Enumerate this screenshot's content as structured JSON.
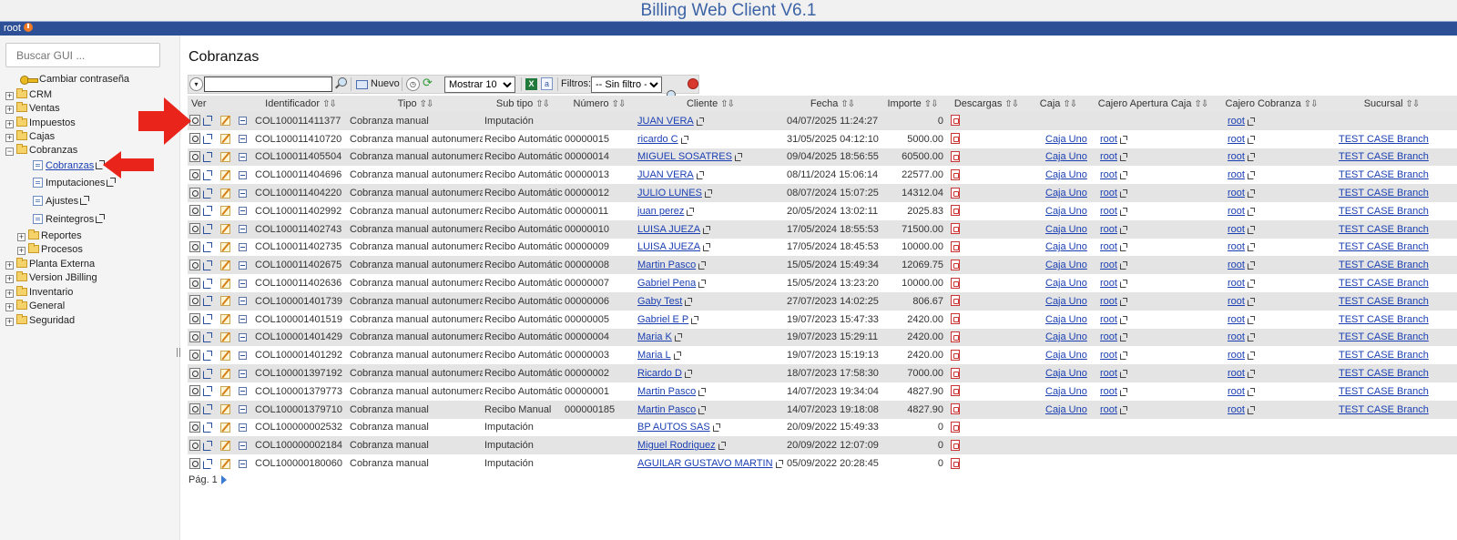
{
  "app": {
    "title": "Billing Web Client V6.1",
    "user": "root"
  },
  "sidebar": {
    "search_placeholder": "Buscar GUI ...",
    "change_password": "Cambiar contraseña",
    "items": [
      {
        "label": "CRM",
        "expanded": false
      },
      {
        "label": "Ventas",
        "expanded": false
      },
      {
        "label": "Impuestos",
        "expanded": false
      },
      {
        "label": "Cajas",
        "expanded": false
      },
      {
        "label": "Cobranzas",
        "expanded": true
      }
    ],
    "cobranzas_children": [
      "Cobranzas",
      "Imputaciones",
      "Ajustes",
      "Reintegros"
    ],
    "cobranzas_folders": [
      "Reportes",
      "Procesos"
    ],
    "bottom_items": [
      "Planta Externa",
      "Version JBilling",
      "Inventario",
      "General",
      "Seguridad"
    ]
  },
  "main": {
    "title": "Cobranzas",
    "toolbar": {
      "new_label": "Nuevo",
      "show_label": "Mostrar 10",
      "filters_label": "Filtros:",
      "filter_value": "-- Sin filtro --"
    },
    "columns": [
      "Ver",
      "Identificador",
      "Tipo",
      "Sub tipo",
      "Número",
      "Cliente",
      "Fecha",
      "Importe",
      "Descargas",
      "Caja",
      "Cajero Apertura Caja",
      "Cajero Cobranza",
      "Sucursal"
    ],
    "rows": [
      {
        "id": "COL100011411377",
        "tipo": "Cobranza manual",
        "subtipo": "Imputación",
        "numero": "",
        "cliente": "JUAN VERA",
        "fecha": "04/07/2025 11:24:27",
        "importe": "0",
        "caja": "",
        "cajero_apertura": "",
        "cajero_cobranza": "root",
        "sucursal": ""
      },
      {
        "id": "COL100011410720",
        "tipo": "Cobranza manual autonumerada",
        "subtipo": "Recibo Automático",
        "numero": "00000015",
        "cliente": "ricardo C",
        "fecha": "31/05/2025 04:12:10",
        "importe": "5000.00",
        "caja": "Caja Uno",
        "cajero_apertura": "root",
        "cajero_cobranza": "root",
        "sucursal": "TEST CASE Branch"
      },
      {
        "id": "COL100011405504",
        "tipo": "Cobranza manual autonumerada",
        "subtipo": "Recibo Automático",
        "numero": "00000014",
        "cliente": "MIGUEL SOSATRES",
        "fecha": "09/04/2025 18:56:55",
        "importe": "60500.00",
        "caja": "Caja Uno",
        "cajero_apertura": "root",
        "cajero_cobranza": "root",
        "sucursal": "TEST CASE Branch"
      },
      {
        "id": "COL100011404696",
        "tipo": "Cobranza manual autonumerada",
        "subtipo": "Recibo Automático",
        "numero": "00000013",
        "cliente": "JUAN VERA",
        "fecha": "08/11/2024 15:06:14",
        "importe": "22577.00",
        "caja": "Caja Uno",
        "cajero_apertura": "root",
        "cajero_cobranza": "root",
        "sucursal": "TEST CASE Branch"
      },
      {
        "id": "COL100011404220",
        "tipo": "Cobranza manual autonumerada",
        "subtipo": "Recibo Automático",
        "numero": "00000012",
        "cliente": "JULIO LUNES",
        "fecha": "08/07/2024 15:07:25",
        "importe": "14312.04",
        "caja": "Caja Uno",
        "cajero_apertura": "root",
        "cajero_cobranza": "root",
        "sucursal": "TEST CASE Branch"
      },
      {
        "id": "COL100011402992",
        "tipo": "Cobranza manual autonumerada",
        "subtipo": "Recibo Automático",
        "numero": "00000011",
        "cliente": "juan perez",
        "fecha": "20/05/2024 13:02:11",
        "importe": "2025.83",
        "caja": "Caja Uno",
        "cajero_apertura": "root",
        "cajero_cobranza": "root",
        "sucursal": "TEST CASE Branch"
      },
      {
        "id": "COL100011402743",
        "tipo": "Cobranza manual autonumerada",
        "subtipo": "Recibo Automático",
        "numero": "00000010",
        "cliente": "LUISA JUEZA",
        "fecha": "17/05/2024 18:55:53",
        "importe": "71500.00",
        "caja": "Caja Uno",
        "cajero_apertura": "root",
        "cajero_cobranza": "root",
        "sucursal": "TEST CASE Branch"
      },
      {
        "id": "COL100011402735",
        "tipo": "Cobranza manual autonumerada",
        "subtipo": "Recibo Automático",
        "numero": "00000009",
        "cliente": "LUISA JUEZA",
        "fecha": "17/05/2024 18:45:53",
        "importe": "10000.00",
        "caja": "Caja Uno",
        "cajero_apertura": "root",
        "cajero_cobranza": "root",
        "sucursal": "TEST CASE Branch"
      },
      {
        "id": "COL100011402675",
        "tipo": "Cobranza manual autonumerada",
        "subtipo": "Recibo Automático",
        "numero": "00000008",
        "cliente": "Martin Pasco",
        "fecha": "15/05/2024 15:49:34",
        "importe": "12069.75",
        "caja": "Caja Uno",
        "cajero_apertura": "root",
        "cajero_cobranza": "root",
        "sucursal": "TEST CASE Branch"
      },
      {
        "id": "COL100011402636",
        "tipo": "Cobranza manual autonumerada",
        "subtipo": "Recibo Automático",
        "numero": "00000007",
        "cliente": "Gabriel Pena",
        "fecha": "15/05/2024 13:23:20",
        "importe": "10000.00",
        "caja": "Caja Uno",
        "cajero_apertura": "root",
        "cajero_cobranza": "root",
        "sucursal": "TEST CASE Branch"
      },
      {
        "id": "COL100001401739",
        "tipo": "Cobranza manual autonumerada",
        "subtipo": "Recibo Automático",
        "numero": "00000006",
        "cliente": "Gaby Test",
        "fecha": "27/07/2023 14:02:25",
        "importe": "806.67",
        "caja": "Caja Uno",
        "cajero_apertura": "root",
        "cajero_cobranza": "root",
        "sucursal": "TEST CASE Branch"
      },
      {
        "id": "COL100001401519",
        "tipo": "Cobranza manual autonumerada",
        "subtipo": "Recibo Automático",
        "numero": "00000005",
        "cliente": "Gabriel E P",
        "fecha": "19/07/2023 15:47:33",
        "importe": "2420.00",
        "caja": "Caja Uno",
        "cajero_apertura": "root",
        "cajero_cobranza": "root",
        "sucursal": "TEST CASE Branch"
      },
      {
        "id": "COL100001401429",
        "tipo": "Cobranza manual autonumerada",
        "subtipo": "Recibo Automático",
        "numero": "00000004",
        "cliente": "Maria K",
        "fecha": "19/07/2023 15:29:11",
        "importe": "2420.00",
        "caja": "Caja Uno",
        "cajero_apertura": "root",
        "cajero_cobranza": "root",
        "sucursal": "TEST CASE Branch"
      },
      {
        "id": "COL100001401292",
        "tipo": "Cobranza manual autonumerada",
        "subtipo": "Recibo Automático",
        "numero": "00000003",
        "cliente": "Maria L",
        "fecha": "19/07/2023 15:19:13",
        "importe": "2420.00",
        "caja": "Caja Uno",
        "cajero_apertura": "root",
        "cajero_cobranza": "root",
        "sucursal": "TEST CASE Branch"
      },
      {
        "id": "COL100001397192",
        "tipo": "Cobranza manual autonumerada",
        "subtipo": "Recibo Automático",
        "numero": "00000002",
        "cliente": "Ricardo D",
        "fecha": "18/07/2023 17:58:30",
        "importe": "7000.00",
        "caja": "Caja Uno",
        "cajero_apertura": "root",
        "cajero_cobranza": "root",
        "sucursal": "TEST CASE Branch"
      },
      {
        "id": "COL100001379773",
        "tipo": "Cobranza manual autonumerada",
        "subtipo": "Recibo Automático",
        "numero": "00000001",
        "cliente": "Martin Pasco",
        "fecha": "14/07/2023 19:34:04",
        "importe": "4827.90",
        "caja": "Caja Uno",
        "cajero_apertura": "root",
        "cajero_cobranza": "root",
        "sucursal": "TEST CASE Branch"
      },
      {
        "id": "COL100001379710",
        "tipo": "Cobranza manual",
        "subtipo": "Recibo Manual",
        "numero": "000000185",
        "cliente": "Martin Pasco",
        "fecha": "14/07/2023 19:18:08",
        "importe": "4827.90",
        "caja": "Caja Uno",
        "cajero_apertura": "root",
        "cajero_cobranza": "root",
        "sucursal": "TEST CASE Branch"
      },
      {
        "id": "COL100000002532",
        "tipo": "Cobranza manual",
        "subtipo": "Imputación",
        "numero": "",
        "cliente": "BP AUTOS SAS",
        "fecha": "20/09/2022 15:49:33",
        "importe": "0",
        "caja": "",
        "cajero_apertura": "",
        "cajero_cobranza": "",
        "sucursal": ""
      },
      {
        "id": "COL100000002184",
        "tipo": "Cobranza manual",
        "subtipo": "Imputación",
        "numero": "",
        "cliente": "Miguel Rodriguez",
        "fecha": "20/09/2022 12:07:09",
        "importe": "0",
        "caja": "",
        "cajero_apertura": "",
        "cajero_cobranza": "",
        "sucursal": ""
      },
      {
        "id": "COL100000180060",
        "tipo": "Cobranza manual",
        "subtipo": "Imputación",
        "numero": "",
        "cliente": "AGUILAR GUSTAVO MARTIN",
        "fecha": "05/09/2022 20:28:45",
        "importe": "0",
        "caja": "",
        "cajero_apertura": "",
        "cajero_cobranza": "",
        "sucursal": ""
      }
    ],
    "pager": {
      "label": "Pág. 1"
    }
  },
  "colors": {
    "accent_red": "#e8241b",
    "header_blue": "#2c4f95",
    "link": "#1a3fb3"
  }
}
